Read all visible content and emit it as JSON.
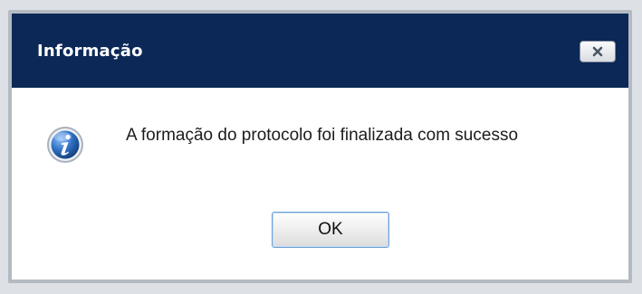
{
  "dialog": {
    "title": "Informação",
    "close_icon": "close-icon",
    "message_icon": "info-icon",
    "message": "A formação do protocolo foi finalizada com sucesso",
    "ok_label": "OK"
  },
  "colors": {
    "titlebar": "#0b2856",
    "title_text": "#ffffff",
    "icon_blue": "#2f6fc0",
    "ok_border": "#6aa0d8"
  }
}
